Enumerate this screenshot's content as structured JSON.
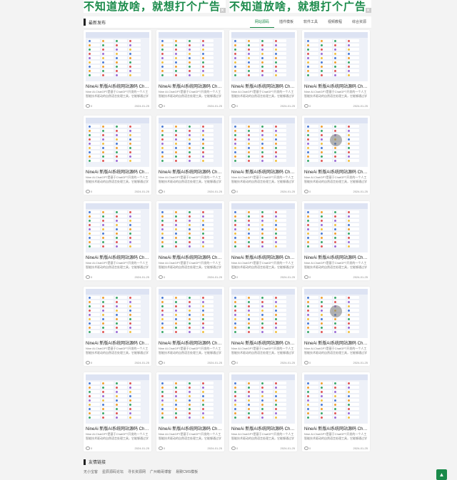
{
  "ads": [
    {
      "text": "不知道放啥，就想打个广告"
    },
    {
      "text": "不知道放啥，就想打个广告"
    }
  ],
  "section": {
    "title": "最新发布"
  },
  "tabs": [
    {
      "label": "网站源码",
      "active": true
    },
    {
      "label": "插件模板",
      "active": false
    },
    {
      "label": "软件工具",
      "active": false
    },
    {
      "label": "视频教程",
      "active": false
    },
    {
      "label": "综合资源",
      "active": false
    }
  ],
  "cards": [
    {
      "title": "NineAi 新版AI系统网站源码 ChatGPT",
      "desc": "Nine AI.ChatGPT是基于ChatGPT开发的一个人工智能技术驱动的自然语言处理工具，它能够通过学",
      "views": "0",
      "date": "2024-01-25",
      "play": false
    },
    {
      "title": "NineAi 新版AI系统网站源码 ChatGPT",
      "desc": "Nine AI.ChatGPT是基于ChatGPT开发的一个人工智能技术驱动的自然语言处理工具，它能够通过学",
      "views": "0",
      "date": "2024-01-25",
      "play": false
    },
    {
      "title": "NineAi 新版AI系统网站源码 ChatGPT",
      "desc": "Nine AI.ChatGPT是基于ChatGPT开发的一个人工智能技术驱动的自然语言处理工具，它能够通过学",
      "views": "0",
      "date": "2024-01-25",
      "play": false
    },
    {
      "title": "NineAi 新版AI系统网站源码 ChatGPT",
      "desc": "Nine AI.ChatGPT是基于ChatGPT开发的一个人工智能技术驱动的自然语言处理工具，它能够通过学",
      "views": "0",
      "date": "2024-01-25",
      "play": false
    },
    {
      "title": "NineAi 新版AI系统网站源码 ChatGPT",
      "desc": "Nine AI.ChatGPT是基于ChatGPT开发的一个人工智能技术驱动的自然语言处理工具，它能够通过学",
      "views": "0",
      "date": "2024-01-25",
      "play": false
    },
    {
      "title": "NineAi 新版AI系统网站源码 ChatGPT",
      "desc": "Nine AI.ChatGPT是基于ChatGPT开发的一个人工智能技术驱动的自然语言处理工具，它能够通过学",
      "views": "0",
      "date": "2024-01-25",
      "play": false
    },
    {
      "title": "NineAi 新版AI系统网站源码 ChatGPT",
      "desc": "Nine AI.ChatGPT是基于ChatGPT开发的一个人工智能技术驱动的自然语言处理工具，它能够通过学",
      "views": "0",
      "date": "2024-01-25",
      "play": false
    },
    {
      "title": "NineAi 新版AI系统网站源码 ChatGPT",
      "desc": "Nine AI.ChatGPT是基于ChatGPT开发的一个人工智能技术驱动的自然语言处理工具，它能够通过学",
      "views": "0",
      "date": "2024-01-25",
      "play": true
    },
    {
      "title": "NineAi 新版AI系统网站源码 ChatGPT",
      "desc": "Nine AI.ChatGPT是基于ChatGPT开发的一个人工智能技术驱动的自然语言处理工具，它能够通过学",
      "views": "0",
      "date": "2024-01-25",
      "play": false
    },
    {
      "title": "NineAi 新版AI系统网站源码 ChatGPT",
      "desc": "Nine AI.ChatGPT是基于ChatGPT开发的一个人工智能技术驱动的自然语言处理工具，它能够通过学",
      "views": "0",
      "date": "2024-01-25",
      "play": false
    },
    {
      "title": "NineAi 新版AI系统网站源码 ChatGPT",
      "desc": "Nine AI.ChatGPT是基于ChatGPT开发的一个人工智能技术驱动的自然语言处理工具，它能够通过学",
      "views": "0",
      "date": "2024-01-25",
      "play": false
    },
    {
      "title": "NineAi 新版AI系统网站源码 ChatGPT",
      "desc": "Nine AI.ChatGPT是基于ChatGPT开发的一个人工智能技术驱动的自然语言处理工具，它能够通过学",
      "views": "0",
      "date": "2024-01-25",
      "play": false
    },
    {
      "title": "NineAi 新版AI系统网站源码 ChatGPT",
      "desc": "Nine AI.ChatGPT是基于ChatGPT开发的一个人工智能技术驱动的自然语言处理工具，它能够通过学",
      "views": "0",
      "date": "2024-01-25",
      "play": false
    },
    {
      "title": "NineAi 新版AI系统网站源码 ChatGPT",
      "desc": "Nine AI.ChatGPT是基于ChatGPT开发的一个人工智能技术驱动的自然语言处理工具，它能够通过学",
      "views": "0",
      "date": "2024-01-25",
      "play": false
    },
    {
      "title": "NineAi 新版AI系统网站源码 ChatGPT",
      "desc": "Nine AI.ChatGPT是基于ChatGPT开发的一个人工智能技术驱动的自然语言处理工具，它能够通过学",
      "views": "0",
      "date": "2024-01-25",
      "play": false
    },
    {
      "title": "NineAi 新版AI系统网站源码 ChatGPT",
      "desc": "Nine AI.ChatGPT是基于ChatGPT开发的一个人工智能技术驱动的自然语言处理工具，它能够通过学",
      "views": "0",
      "date": "2024-01-25",
      "play": true
    },
    {
      "title": "NineAi 新版AI系统网站源码 ChatGPT",
      "desc": "Nine AI.ChatGPT是基于ChatGPT开发的一个人工智能技术驱动的自然语言处理工具，它能够通过学",
      "views": "0",
      "date": "2024-01-25",
      "play": false
    },
    {
      "title": "NineAi 新版AI系统网站源码 ChatGPT",
      "desc": "Nine AI.ChatGPT是基于ChatGPT开发的一个人工智能技术驱动的自然语言处理工具，它能够通过学",
      "views": "0",
      "date": "2024-01-25",
      "play": false
    },
    {
      "title": "NineAi 新版AI系统网站源码 ChatGPT",
      "desc": "Nine AI.ChatGPT是基于ChatGPT开发的一个人工智能技术驱动的自然语言处理工具，它能够通过学",
      "views": "0",
      "date": "2024-01-25",
      "play": false
    },
    {
      "title": "NineAi 新版AI系统网站源码 ChatGPT",
      "desc": "Nine AI.ChatGPT是基于ChatGPT开发的一个人工智能技术驱动的自然语言处理工具，它能够通过学",
      "views": "0",
      "date": "2024-01-25",
      "play": false
    }
  ],
  "friend_links": {
    "title": "友情链接",
    "items": [
      "无小宝客",
      "星辰源码论坛",
      "寻长资源网",
      "广州萌哥博客",
      "易致CMS模板"
    ]
  },
  "colors": {
    "accent": "#1a8a4a",
    "thumb_bg": "#eef1f8"
  },
  "icons": {
    "ad_close": "close-icon",
    "views": "eye-icon",
    "back_to_top": "arrow-up-icon"
  }
}
